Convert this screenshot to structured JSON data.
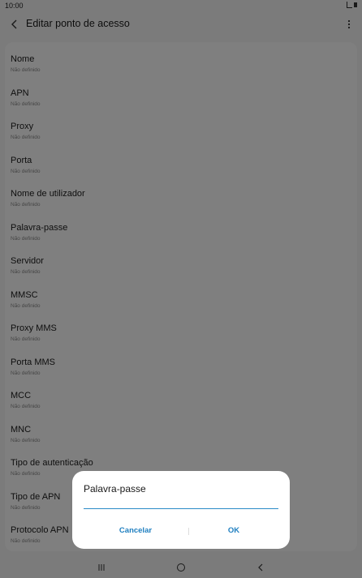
{
  "status": {
    "time": "10:00"
  },
  "appbar": {
    "title": "Editar ponto de acesso"
  },
  "settings": [
    {
      "label": "Nome",
      "value": "Não definido"
    },
    {
      "label": "APN",
      "value": "Não definido"
    },
    {
      "label": "Proxy",
      "value": "Não definido"
    },
    {
      "label": "Porta",
      "value": "Não definido"
    },
    {
      "label": "Nome de utilizador",
      "value": "Não definido"
    },
    {
      "label": "Palavra-passe",
      "value": "Não definido"
    },
    {
      "label": "Servidor",
      "value": "Não definido"
    },
    {
      "label": "MMSC",
      "value": "Não definido"
    },
    {
      "label": "Proxy MMS",
      "value": "Não definido"
    },
    {
      "label": "Porta MMS",
      "value": "Não definido"
    },
    {
      "label": "MCC",
      "value": "Não definido"
    },
    {
      "label": "MNC",
      "value": "Não definido"
    },
    {
      "label": "Tipo de autenticação",
      "value": "Não definido"
    },
    {
      "label": "Tipo de APN",
      "value": "Não definido"
    },
    {
      "label": "Protocolo APN",
      "value": "Não definido"
    }
  ],
  "dialog": {
    "title": "Palavra-passe",
    "input_value": "",
    "cancel_label": "Cancelar",
    "ok_label": "OK"
  },
  "colors": {
    "accent": "#1f7fc0",
    "underline": "#2a8bc7"
  },
  "icons": {
    "back": "chevron-left-icon",
    "more": "more-vertical-icon",
    "nav_recent": "recent-apps-icon",
    "nav_home": "home-icon",
    "nav_back": "nav-back-icon"
  }
}
